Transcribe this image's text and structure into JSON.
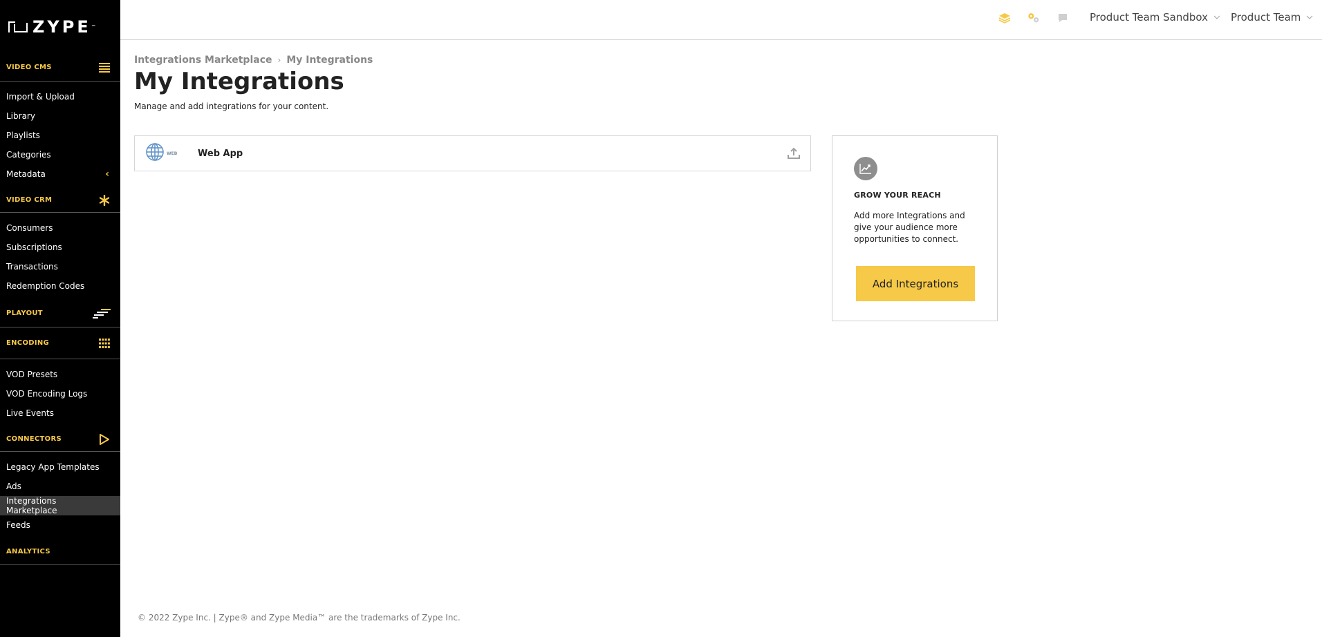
{
  "brand": {
    "name": "ZYPE",
    "tm": "™"
  },
  "sidebar": {
    "video_cms": {
      "title": "VIDEO CMS",
      "icon": "menu-lines-icon",
      "items": [
        "Import & Upload",
        "Library",
        "Playlists",
        "Categories",
        "Metadata"
      ]
    },
    "video_crm": {
      "title": "VIDEO CRM",
      "icon": "asterisk-icon",
      "items": [
        "Consumers",
        "Subscriptions",
        "Transactions",
        "Redemption Codes"
      ]
    },
    "playout": {
      "title": "PLAYOUT",
      "icon": "playout-lines-icon"
    },
    "encoding": {
      "title": "ENCODING",
      "icon": "grid-icon",
      "items": [
        "VOD Presets",
        "VOD Encoding Logs",
        "Live Events"
      ]
    },
    "connectors": {
      "title": "CONNECTORS",
      "icon": "play-outline-icon",
      "items": [
        "Legacy App Templates",
        "Ads",
        "Integrations Marketplace",
        "Feeds"
      ]
    },
    "analytics": {
      "title": "ANALYTICS"
    },
    "accent_color": "#f7c948",
    "active_item": "Integrations Marketplace"
  },
  "header": {
    "icons": [
      "layers-icon",
      "gears-icon",
      "chat-icon"
    ],
    "account_dropdown": "Product Team Sandbox",
    "team_dropdown": "Product Team"
  },
  "breadcrumb": {
    "parent": "Integrations Marketplace",
    "current": "My Integrations"
  },
  "page": {
    "title": "My Integrations",
    "description": "Manage and add integrations for your content."
  },
  "integrations": [
    {
      "name": "Web App",
      "logo_tag": "WEB",
      "icon": "globe-icon",
      "action_icon": "upload-icon"
    }
  ],
  "promo": {
    "icon": "trend-chart-icon",
    "title": "GROW YOUR REACH",
    "text": "Add more Integrations and give your audience more opportunities to connect.",
    "button": "Add Integrations",
    "button_color": "#f7c948"
  },
  "footer": {
    "text": "© 2022 Zype Inc. | Zype® and Zype Media™ are the trademarks of Zype Inc."
  }
}
